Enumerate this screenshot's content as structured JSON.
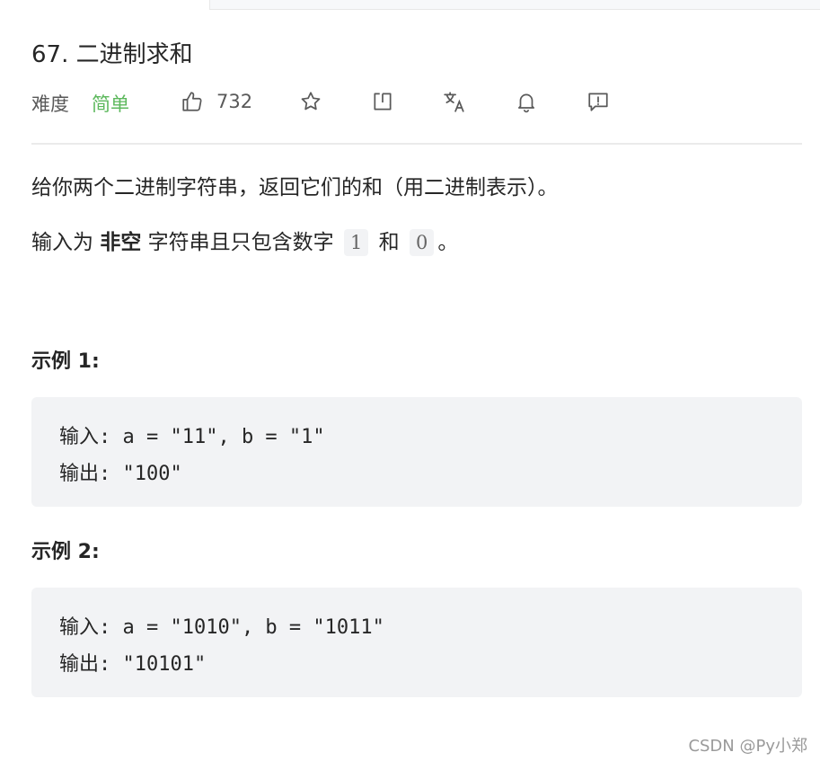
{
  "problem": {
    "title": "67. 二进制求和",
    "difficulty_label": "难度",
    "difficulty_value": "简单",
    "likes": "732",
    "colors": {
      "easy": "#5cb85c",
      "code_bg": "#f2f3f5",
      "text": "#262626"
    }
  },
  "toolbar": {
    "icons": [
      "thumbs-up-icon",
      "star-icon",
      "share-icon",
      "translate-icon",
      "bell-icon",
      "feedback-icon"
    ]
  },
  "description": {
    "p1": "给你两个二进制字符串，返回它们的和（用二进制表示）。",
    "p2_pre": "输入为 ",
    "p2_bold": "非空",
    "p2_mid": " 字符串且只包含数字 ",
    "p2_code1": "1",
    "p2_and": " 和 ",
    "p2_code2": "0",
    "p2_end": "。"
  },
  "examples": [
    {
      "title": "示例 1:",
      "input": "输入: a = \"11\", b = \"1\"",
      "output": "输出: \"100\""
    },
    {
      "title": "示例 2:",
      "input": "输入: a = \"1010\", b = \"1011\"",
      "output": "输出: \"10101\""
    }
  ],
  "watermark": "CSDN @Py小郑"
}
